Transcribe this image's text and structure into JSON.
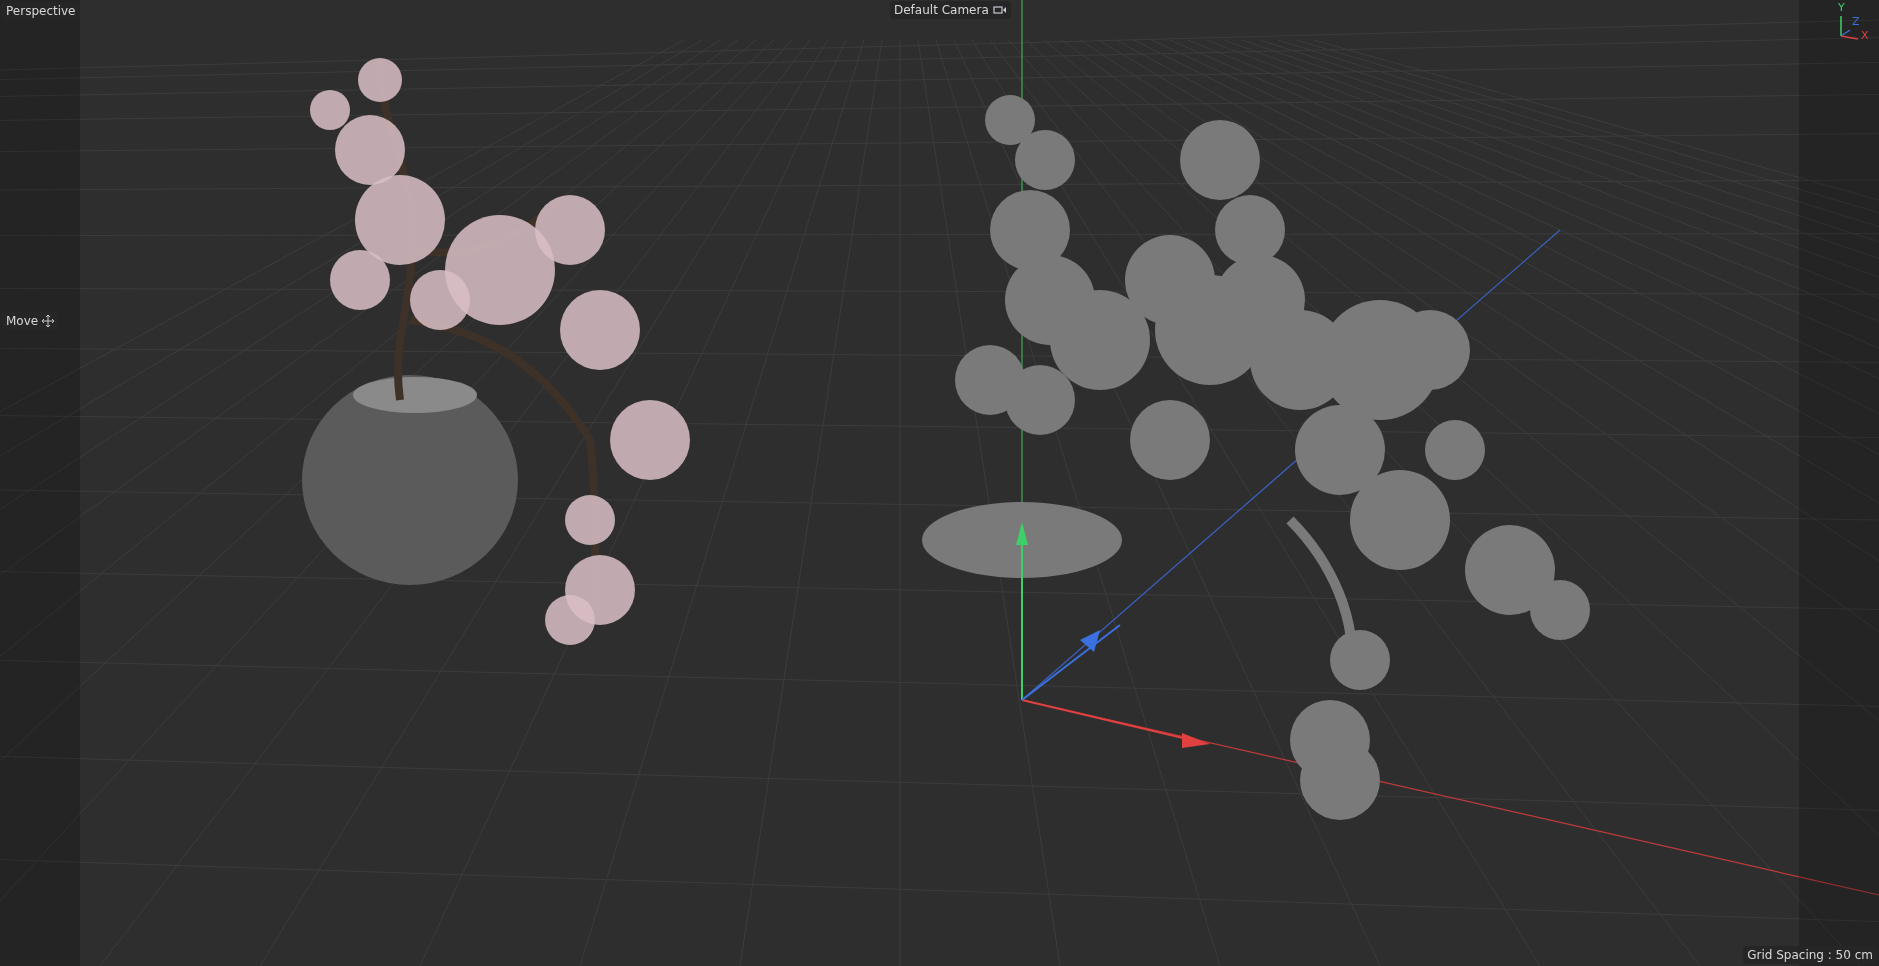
{
  "viewport": {
    "view_name": "Perspective",
    "camera": "Default Camera",
    "tool": "Move",
    "grid_spacing": "Grid Spacing : 50 cm"
  },
  "axis_labels": [
    {
      "kind": "y",
      "label": "Y"
    },
    {
      "kind": "z",
      "label": "Z"
    },
    {
      "kind": "x",
      "label": "X"
    }
  ]
}
